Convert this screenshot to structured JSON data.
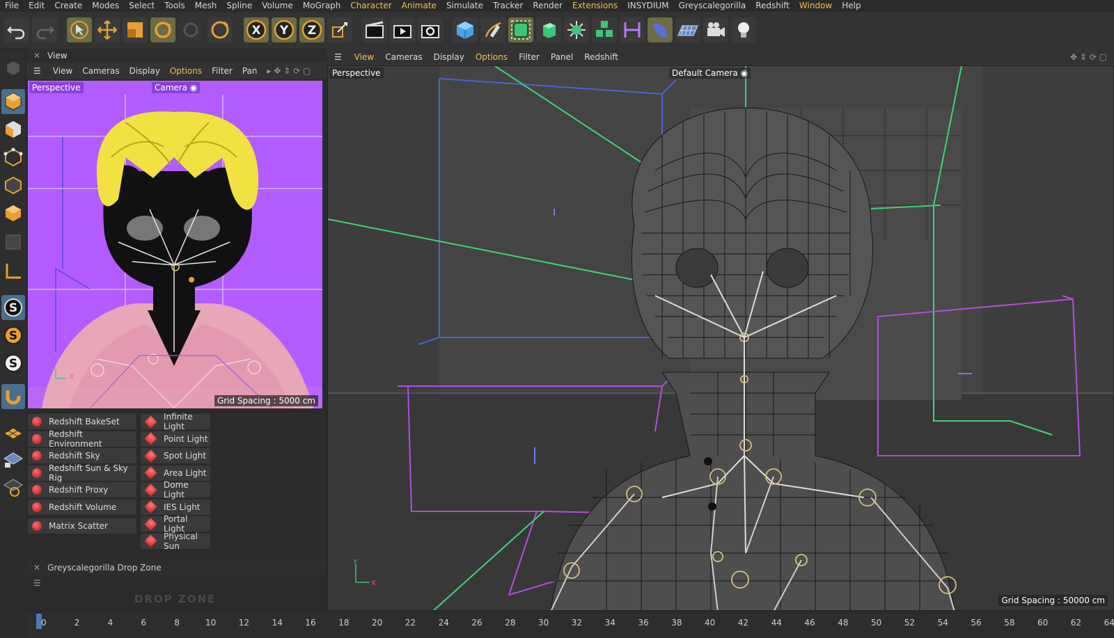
{
  "menubar": [
    "File",
    "Edit",
    "Create",
    "Modes",
    "Select",
    "Tools",
    "Mesh",
    "Spline",
    "Volume",
    "MoGraph",
    "Character",
    "Animate",
    "Simulate",
    "Tracker",
    "Render",
    "Extensions",
    "INSYDIUM",
    "Greyscalegorilla",
    "Redshift",
    "Window",
    "Help"
  ],
  "menubar_accent": [
    "Character",
    "Animate",
    "Extensions",
    "Window"
  ],
  "small_view": {
    "panel_title": "View",
    "menu": [
      "View",
      "Cameras",
      "Display",
      "Options",
      "Filter",
      "Pan"
    ],
    "projection": "Perspective",
    "camera": "Camera",
    "grid_spacing": "Grid Spacing : 5000 cm",
    "bg_color": "#b25cff"
  },
  "objects_left": [
    "Redshift BakeSet",
    "Redshift Environment",
    "Redshift Sky",
    "Redshift Sun & Sky Rig",
    "Redshift Proxy",
    "Redshift Volume",
    "Matrix Scatter"
  ],
  "objects_right": [
    "Infinite Light",
    "Point Light",
    "Spot Light",
    "Area Light",
    "Dome Light",
    "IES Light",
    "Portal Light",
    "Physical Sun"
  ],
  "dropzone": {
    "title": "Greyscalegorilla Drop Zone",
    "logo": "DROP ZONE"
  },
  "main_view": {
    "menu": [
      "View",
      "Cameras",
      "Display",
      "Options",
      "Filter",
      "Panel",
      "Redshift"
    ],
    "projection": "Perspective",
    "camera": "Default Camera",
    "grid_spacing": "Grid Spacing : 50000 cm"
  },
  "timeline": {
    "ticks": [
      "0",
      "2",
      "4",
      "6",
      "8",
      "10",
      "12",
      "14",
      "16",
      "18",
      "20",
      "22",
      "24",
      "26",
      "28",
      "30",
      "32",
      "34",
      "36",
      "38",
      "40",
      "42",
      "44",
      "46",
      "48",
      "50",
      "52",
      "54",
      "56",
      "58",
      "60",
      "62",
      "64"
    ],
    "current": "0"
  },
  "colors": {
    "accent": "#f0c050",
    "selected_tool": "#6b6b45",
    "wire": "#1a1a1a"
  }
}
